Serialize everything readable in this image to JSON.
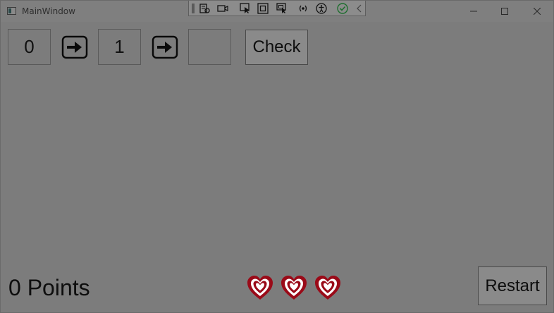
{
  "window": {
    "title": "MainWindow"
  },
  "debug_toolbar": {
    "icons": [
      "live-visual-tree-icon",
      "video-capture-icon",
      "select-element-icon",
      "display-layout-adorners-icon",
      "track-focused-element-icon",
      "binding-failures-icon",
      "accessibility-checker-icon",
      "ok-status-icon",
      "collapse-icon"
    ]
  },
  "sequence": {
    "first_value": "0",
    "second_value": "1",
    "answer_value": "",
    "check_label": "Check"
  },
  "footer": {
    "points_text": "0 Points",
    "lives": 3,
    "restart_label": "Restart"
  },
  "colors": {
    "heart_outer": "#9a0a18",
    "heart_inner": "#ffffff",
    "overlay": "#7c7c7c"
  }
}
